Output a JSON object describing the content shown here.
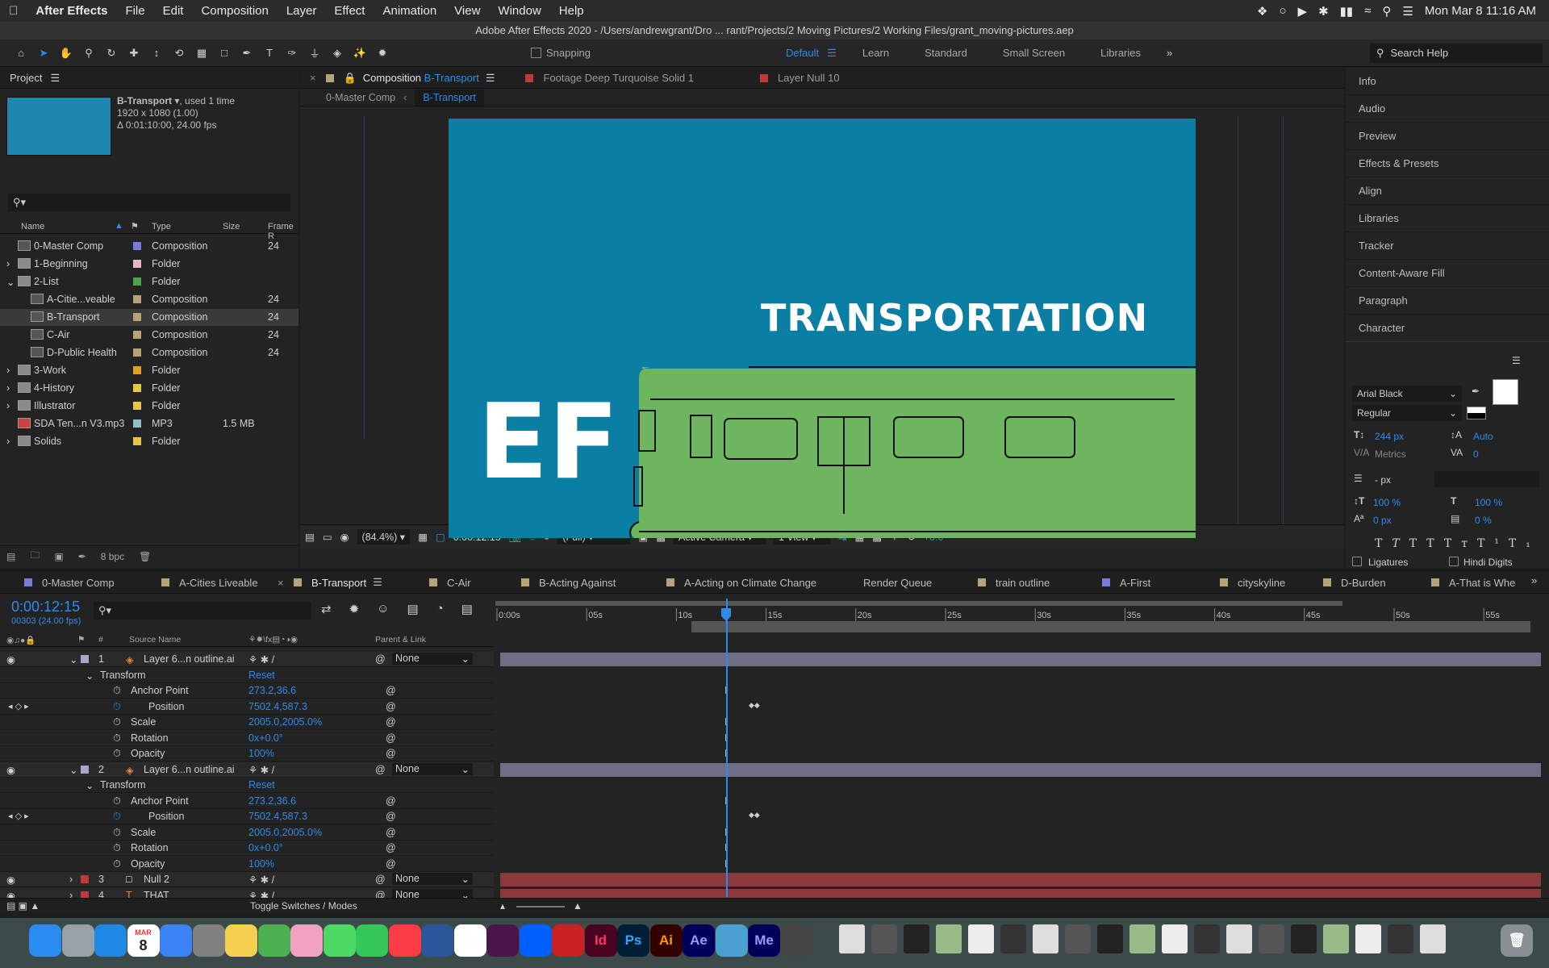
{
  "menubar": {
    "app": "After Effects",
    "items": [
      "File",
      "Edit",
      "Composition",
      "Layer",
      "Effect",
      "Animation",
      "View",
      "Window",
      "Help"
    ],
    "datetime": "Mon Mar 8  11:16 AM"
  },
  "window_title": "Adobe After Effects 2020 - /Users/andrewgrant/Dro ... rant/Projects/2 Moving Pictures/2 Working Files/grant_moving-pictures.aep",
  "toolbar": {
    "snapping": "Snapping",
    "workspaces": [
      "Default",
      "Learn",
      "Standard",
      "Small Screen",
      "Libraries"
    ],
    "search": "Search Help"
  },
  "project": {
    "title": "Project",
    "selected": {
      "name": "B-Transport",
      "used": ", used 1 time",
      "dims": "1920 x 1080 (1.00)",
      "duration": "Δ 0:01:10:00, 24.00 fps",
      "thumb_color": "#1e87ad"
    },
    "columns": {
      "name": "Name",
      "type": "Type",
      "size": "Size",
      "frame": "Frame R"
    },
    "bpc": "8 bpc",
    "items": [
      {
        "name": "0-Master Comp",
        "type": "Composition",
        "size": "",
        "frame": "24",
        "color": "#7a7ad8"
      },
      {
        "name": "1-Beginning",
        "type": "Folder",
        "size": "",
        "frame": "",
        "color": "#e9b8c8"
      },
      {
        "name": "2-List",
        "type": "Folder",
        "size": "",
        "frame": "",
        "color": "#4ca34c"
      },
      {
        "name": "A-Citie...veable",
        "type": "Composition",
        "size": "",
        "frame": "24",
        "color": "#b7a27a"
      },
      {
        "name": "B-Transport",
        "type": "Composition",
        "size": "",
        "frame": "24",
        "color": "#b7a27a"
      },
      {
        "name": "C-Air",
        "type": "Composition",
        "size": "",
        "frame": "24",
        "color": "#b7a27a"
      },
      {
        "name": "D-Public Health",
        "type": "Composition",
        "size": "",
        "frame": "24",
        "color": "#b7a27a"
      },
      {
        "name": "3-Work",
        "type": "Folder",
        "size": "",
        "frame": "",
        "color": "#e0a020"
      },
      {
        "name": "4-History",
        "type": "Folder",
        "size": "",
        "frame": "",
        "color": "#e6c840"
      },
      {
        "name": "Illustrator",
        "type": "Folder",
        "size": "",
        "frame": "",
        "color": "#e6c840"
      },
      {
        "name": "SDA Ten...n V3.mp3",
        "type": "MP3",
        "size": "1.5 MB",
        "frame": "",
        "color": "#8fc0c8"
      },
      {
        "name": "Solids",
        "type": "Folder",
        "size": "",
        "frame": "",
        "color": "#e6c840"
      }
    ]
  },
  "viewer": {
    "tabs": [
      {
        "label": "Composition",
        "suffix": "B-Transport"
      },
      {
        "label": "Footage Deep Turquoise Solid 1"
      },
      {
        "label": "Layer Null 10"
      }
    ],
    "breadcrumbs": [
      "0-Master Comp",
      "B-Transport"
    ],
    "canvas_text": {
      "headline": "TRANSPORTATION",
      "partial": "EF"
    },
    "footer": {
      "zoom": "(84.4%)",
      "timecode": "0:00:12:15",
      "resolution": "(Full)",
      "camera": "Active Camera",
      "views": "1 View",
      "exposure": "+0.0"
    }
  },
  "right_panel": {
    "items": [
      "Info",
      "Audio",
      "Preview",
      "Effects & Presets",
      "Align",
      "Libraries",
      "Tracker",
      "Content-Aware Fill",
      "Paragraph",
      "Character"
    ],
    "character": {
      "font": "Arial Black",
      "style": "Regular",
      "size": "244 px",
      "leading": "Auto",
      "kerning": "Metrics",
      "tracking": "0",
      "stroke": "- px",
      "vscale": "100 %",
      "hscale": "100 %",
      "baseline": "0 px",
      "tsume": "0 %",
      "ligatures": "Ligatures",
      "hindi": "Hindi Digits"
    }
  },
  "timeline": {
    "tabs": [
      {
        "label": "0-Master Comp",
        "color": "#7a7ad8"
      },
      {
        "label": "A-Cities Liveable",
        "color": "#b7a27a"
      },
      {
        "label": "B-Transport",
        "color": "#b7a27a"
      },
      {
        "label": "C-Air",
        "color": "#b7a27a"
      },
      {
        "label": "B-Acting Against",
        "color": "#b7a27a"
      },
      {
        "label": "A-Acting on Climate Change",
        "color": "#b7a27a"
      },
      {
        "label": "Render Queue",
        "color": ""
      },
      {
        "label": "train outline",
        "color": "#b7a27a"
      },
      {
        "label": "A-First",
        "color": "#7a7ad8"
      },
      {
        "label": "cityskyline",
        "color": "#b7a27a"
      },
      {
        "label": "D-Burden",
        "color": "#b7a27a"
      },
      {
        "label": "A-That is Whe",
        "color": "#b7a27a"
      }
    ],
    "timecode": "0:00:12:15",
    "frames": "00303 (24.00 fps)",
    "col_source": "Source Name",
    "col_parent": "Parent & Link",
    "ruler": [
      "0:00s",
      "05s",
      "10s",
      "15s",
      "20s",
      "25s",
      "30s",
      "35s",
      "40s",
      "45s",
      "50s",
      "55s"
    ],
    "toggle": "Toggle Switches / Modes",
    "rows": [
      {
        "kind": "layer",
        "num": "1",
        "name": "Layer 6...n outline.ai",
        "parent": "None",
        "color": "#a7a7c9"
      },
      {
        "kind": "group",
        "name": "Transform",
        "value": "Reset"
      },
      {
        "kind": "prop",
        "name": "Anchor Point",
        "value": "273.2,36.6"
      },
      {
        "kind": "prop",
        "name": "Position",
        "value": "7502.4,587.3"
      },
      {
        "kind": "prop",
        "name": "Scale",
        "value": "2005.0,2005.0%"
      },
      {
        "kind": "prop",
        "name": "Rotation",
        "value": "0x+0.0°"
      },
      {
        "kind": "prop",
        "name": "Opacity",
        "value": "100%"
      },
      {
        "kind": "layer",
        "num": "2",
        "name": "Layer 6...n outline.ai",
        "parent": "None",
        "color": "#a7a7c9"
      },
      {
        "kind": "group",
        "name": "Transform",
        "value": "Reset"
      },
      {
        "kind": "prop",
        "name": "Anchor Point",
        "value": "273.2,36.6"
      },
      {
        "kind": "prop",
        "name": "Position",
        "value": "7502.4,587.3"
      },
      {
        "kind": "prop",
        "name": "Scale",
        "value": "2005.0,2005.0%"
      },
      {
        "kind": "prop",
        "name": "Rotation",
        "value": "0x+0.0°"
      },
      {
        "kind": "prop",
        "name": "Opacity",
        "value": "100%"
      },
      {
        "kind": "layer",
        "num": "3",
        "name": "Null 2",
        "parent": "None",
        "color": "#c03a3a"
      },
      {
        "kind": "layer",
        "num": "4",
        "name": "THAT",
        "parent": "None",
        "color": "#c03a3a"
      }
    ]
  },
  "dock": {
    "apps": [
      "Finder",
      "Launchpad",
      "Safari",
      "Calendar",
      "Mail",
      "System Preferences",
      "Notes",
      "Maps",
      "Photos",
      "Messages",
      "FaceTime",
      "Music",
      "Word",
      "Chrome",
      "Slack",
      "Dropbox",
      "Acrobat",
      "Id",
      "Ps",
      "Ai",
      "Ae",
      "Preview",
      "Me",
      "QuickTime"
    ],
    "calendar_month": "MAR",
    "calendar_day": "8"
  }
}
